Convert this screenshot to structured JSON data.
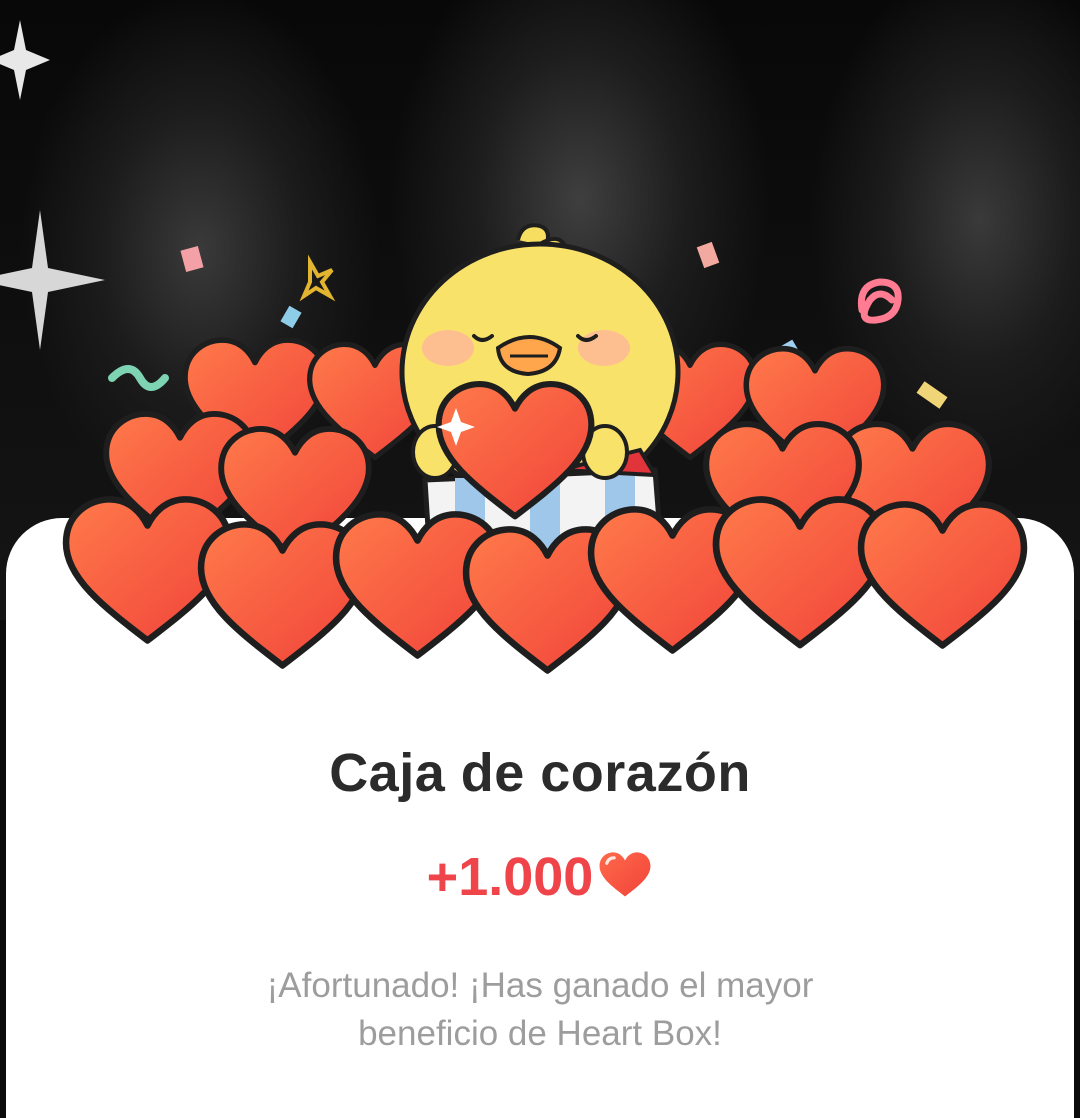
{
  "background": {
    "type": "dark-photo-backdrop",
    "icons": [
      "sparkle-icon",
      "sparkle-icon"
    ]
  },
  "illustration": {
    "icon": "chick-holding-heart-icon",
    "surrounding_icon": "heart-icon",
    "confetti_icon": "confetti-icon",
    "heart_color": "#f04e3e"
  },
  "dialog": {
    "title": "Caja de corazón",
    "reward_amount": "+1.000",
    "reward_icon": "heart-icon",
    "reward_color": "#ef4449",
    "message_line1": "¡Afortunado! ¡Has ganado el mayor",
    "message_line2": "beneficio de Heart Box!"
  }
}
